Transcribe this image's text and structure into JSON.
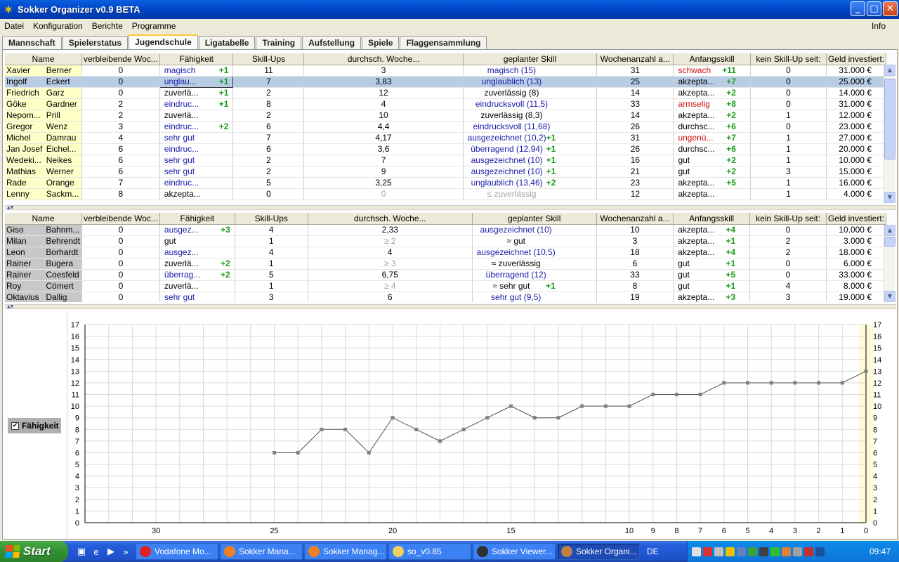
{
  "window": {
    "title": "Sokker Organizer v0.9 BETA"
  },
  "menu": {
    "items": [
      "Datei",
      "Konfiguration",
      "Berichte",
      "Programme"
    ],
    "info": "Info"
  },
  "tabs": [
    {
      "label": "Mannschaft"
    },
    {
      "label": "Spielerstatus"
    },
    {
      "label": "Jugendschule",
      "active": true
    },
    {
      "label": "Ligatabelle"
    },
    {
      "label": "Training"
    },
    {
      "label": "Aufstellung"
    },
    {
      "label": "Spiele"
    },
    {
      "label": "Flaggensammlung"
    }
  ],
  "columns": [
    "Name",
    "verbleibende Woc...",
    "Fähigkeit",
    "Skill-Ups",
    "durchsch. Woche...",
    "geplanter Skill",
    "Wochenanzahl a...",
    "Anfangsskill",
    "kein Skill-Up seit:",
    "Geld investiert:"
  ],
  "top_table": {
    "rows": [
      {
        "first": "Xavier",
        "last": "Berner",
        "weeks": "0",
        "skill": "magisch",
        "skill_up": "+1",
        "skill_color": "blue",
        "ups": "11",
        "avg": "3",
        "planned": "magisch (15)",
        "planned_up": "",
        "planned_color": "blue",
        "wcount": "31",
        "start": "schwach",
        "start_up": "+11",
        "start_color": "red",
        "since": "0",
        "money": "31.000 €"
      },
      {
        "first": "Ingolf",
        "last": "Eckert",
        "weeks": "0",
        "skill": "unglau...",
        "skill_up": "+1",
        "skill_color": "blue",
        "ups": "7",
        "avg": "3,83",
        "planned": "unglaublich (13)",
        "planned_up": "",
        "planned_color": "blue",
        "wcount": "25",
        "start": "akzepta...",
        "start_up": "+7",
        "start_color": "black",
        "since": "0",
        "money": "25.000 €",
        "selected": true
      },
      {
        "first": "Friedrich",
        "last": "Garz",
        "weeks": "0",
        "skill": "zuverlä...",
        "skill_up": "+1",
        "skill_color": "black",
        "ups": "2",
        "avg": "12",
        "planned": "zuverlässig (8)",
        "planned_up": "",
        "planned_color": "black",
        "wcount": "14",
        "start": "akzepta...",
        "start_up": "+2",
        "start_color": "black",
        "since": "0",
        "money": "14.000 €"
      },
      {
        "first": "Göke",
        "last": "Gardner",
        "weeks": "2",
        "skill": "eindruc...",
        "skill_up": "+1",
        "skill_color": "blue",
        "ups": "8",
        "avg": "4",
        "planned": "eindrucksvoll (11,5)",
        "planned_up": "",
        "planned_color": "blue",
        "wcount": "33",
        "start": "armselig",
        "start_up": "+8",
        "start_color": "red",
        "since": "0",
        "money": "31.000 €"
      },
      {
        "first": "Nepom...",
        "last": "Prill",
        "weeks": "2",
        "skill": "zuverlä...",
        "skill_up": "",
        "skill_color": "black",
        "ups": "2",
        "avg": "10",
        "planned": "zuverlässig (8,3)",
        "planned_up": "",
        "planned_color": "black",
        "wcount": "14",
        "start": "akzepta...",
        "start_up": "+2",
        "start_color": "black",
        "since": "1",
        "money": "12.000 €"
      },
      {
        "first": "Gregor",
        "last": "Wenz",
        "weeks": "3",
        "skill": "eindruc...",
        "skill_up": "+2",
        "skill_color": "blue",
        "ups": "6",
        "avg": "4,4",
        "planned": "eindrucksvoll (11,68)",
        "planned_up": "",
        "planned_color": "blue",
        "wcount": "26",
        "start": "durchsc...",
        "start_up": "+6",
        "start_color": "black",
        "since": "0",
        "money": "23.000 €"
      },
      {
        "first": "Michel",
        "last": "Damrau",
        "weeks": "4",
        "skill": "sehr gut",
        "skill_up": "",
        "skill_color": "blue",
        "ups": "7",
        "avg": "4,17",
        "planned": "ausgezeichnet (10,2)",
        "planned_up": "+1",
        "planned_color": "blue",
        "wcount": "31",
        "start": "ungenü...",
        "start_up": "+7",
        "start_color": "red",
        "since": "1",
        "money": "27.000 €"
      },
      {
        "first": "Jan Josef",
        "last": "Eichel...",
        "weeks": "6",
        "skill": "eindruc...",
        "skill_up": "",
        "skill_color": "blue",
        "ups": "6",
        "avg": "3,6",
        "planned": "überragend (12,94)",
        "planned_up": "+1",
        "planned_color": "blue",
        "wcount": "26",
        "start": "durchsc...",
        "start_up": "+6",
        "start_color": "black",
        "since": "1",
        "money": "20.000 €"
      },
      {
        "first": "Wedeki...",
        "last": "Neikes",
        "weeks": "6",
        "skill": "sehr gut",
        "skill_up": "",
        "skill_color": "blue",
        "ups": "2",
        "avg": "7",
        "planned": "ausgezeichnet (10)",
        "planned_up": "+1",
        "planned_color": "blue",
        "wcount": "16",
        "start": "gut",
        "start_up": "+2",
        "start_color": "black",
        "since": "1",
        "money": "10.000 €"
      },
      {
        "first": "Mathias",
        "last": "Werner",
        "weeks": "6",
        "skill": "sehr gut",
        "skill_up": "",
        "skill_color": "blue",
        "ups": "2",
        "avg": "9",
        "planned": "ausgezeichnet (10)",
        "planned_up": "+1",
        "planned_color": "blue",
        "wcount": "21",
        "start": "gut",
        "start_up": "+2",
        "start_color": "black",
        "since": "3",
        "money": "15.000 €"
      },
      {
        "first": "Rade",
        "last": "Orange",
        "weeks": "7",
        "skill": "eindruc...",
        "skill_up": "",
        "skill_color": "blue",
        "ups": "5",
        "avg": "3,25",
        "planned": "unglaublich (13,46)",
        "planned_up": "+2",
        "planned_color": "blue",
        "wcount": "23",
        "start": "akzepta...",
        "start_up": "+5",
        "start_color": "black",
        "since": "1",
        "money": "16.000 €"
      },
      {
        "first": "Lenny",
        "last": "Sackm...",
        "weeks": "8",
        "skill": "akzepta...",
        "skill_up": "",
        "skill_color": "black",
        "ups": "0",
        "avg": "0",
        "avg_color": "gray",
        "planned": "≤ zuverlässig",
        "planned_up": "",
        "planned_color": "gray",
        "wcount": "12",
        "start": "akzepta...",
        "start_up": "",
        "start_color": "black",
        "since": "1",
        "money": "4.000 €"
      }
    ]
  },
  "bottom_table": {
    "rows": [
      {
        "first": "Giso",
        "last": "Bahnm...",
        "weeks": "0",
        "skill": "ausgez...",
        "skill_up": "+3",
        "skill_color": "blue",
        "ups": "4",
        "avg": "2,33",
        "planned": "ausgezeichnet (10)",
        "planned_up": "",
        "planned_color": "blue",
        "wcount": "10",
        "start": "akzepta...",
        "start_up": "+4",
        "start_color": "black",
        "since": "0",
        "money": "10.000 €"
      },
      {
        "first": "Milan",
        "last": "Behrendt",
        "weeks": "0",
        "skill": "gut",
        "skill_up": "",
        "skill_color": "black",
        "ups": "1",
        "avg": "≥ 2",
        "avg_color": "gray",
        "planned": "≈ gut",
        "planned_up": "",
        "planned_color": "black",
        "wcount": "3",
        "start": "akzepta...",
        "start_up": "+1",
        "start_color": "black",
        "since": "2",
        "money": "3.000 €"
      },
      {
        "first": "Leon",
        "last": "Borhardt",
        "weeks": "0",
        "skill": "ausgez...",
        "skill_up": "",
        "skill_color": "blue",
        "ups": "4",
        "avg": "4",
        "planned": "ausgezeichnet (10,5)",
        "planned_up": "",
        "planned_color": "blue",
        "wcount": "18",
        "start": "akzepta...",
        "start_up": "+4",
        "start_color": "black",
        "since": "2",
        "money": "18.000 €"
      },
      {
        "first": "Rainer",
        "last": "Bugera",
        "weeks": "0",
        "skill": "zuverlä...",
        "skill_up": "+2",
        "skill_color": "black",
        "ups": "1",
        "avg": "≥ 3",
        "avg_color": "gray",
        "planned": "≈ zuverlässig",
        "planned_up": "",
        "planned_color": "black",
        "wcount": "6",
        "start": "gut",
        "start_up": "+1",
        "start_color": "black",
        "since": "0",
        "money": "6.000 €"
      },
      {
        "first": "Rainer",
        "last": "Coesfeld",
        "weeks": "0",
        "skill": "überrag...",
        "skill_up": "+2",
        "skill_color": "blue",
        "ups": "5",
        "avg": "6,75",
        "planned": "überragend (12)",
        "planned_up": "",
        "planned_color": "blue",
        "wcount": "33",
        "start": "gut",
        "start_up": "+5",
        "start_color": "black",
        "since": "0",
        "money": "33.000 €"
      },
      {
        "first": "Roy",
        "last": "Cömert",
        "weeks": "0",
        "skill": "zuverlä...",
        "skill_up": "",
        "skill_color": "black",
        "ups": "1",
        "avg": "≥ 4",
        "avg_color": "gray",
        "planned": "≈ sehr gut",
        "planned_up": "+1",
        "planned_color": "black",
        "wcount": "8",
        "start": "gut",
        "start_up": "+1",
        "start_color": "black",
        "since": "4",
        "money": "8.000 €"
      },
      {
        "first": "Oktavius",
        "last": "Dallig",
        "weeks": "0",
        "skill": "sehr gut",
        "skill_up": "",
        "skill_color": "blue",
        "ups": "3",
        "avg": "6",
        "planned": "sehr gut (9,5)",
        "planned_up": "",
        "planned_color": "blue",
        "wcount": "19",
        "start": "akzepta...",
        "start_up": "+3",
        "start_color": "black",
        "since": "3",
        "money": "19.000 €"
      }
    ]
  },
  "chart_data": {
    "type": "line",
    "series": [
      {
        "name": "Fähigkeit",
        "x": [
          25,
          24,
          23,
          22,
          21,
          20,
          19,
          18,
          17,
          16,
          15,
          14,
          13,
          12,
          11,
          10,
          9,
          8,
          7,
          6,
          5,
          4,
          3,
          2,
          1,
          0
        ],
        "values": [
          6,
          6,
          8,
          8,
          6,
          9,
          8,
          7,
          8,
          9,
          10,
          9,
          9,
          10,
          10,
          10,
          11,
          11,
          11,
          12,
          12,
          12,
          12,
          12,
          12,
          13
        ]
      }
    ],
    "xlim": [
      0,
      33
    ],
    "x_ticks": [
      30,
      25,
      20,
      15,
      10,
      9,
      8,
      7,
      6,
      5,
      4,
      3,
      2,
      1,
      0
    ],
    "ylim": [
      0,
      17
    ],
    "y_ticks": [
      0,
      1,
      2,
      3,
      4,
      5,
      6,
      7,
      8,
      9,
      10,
      11,
      12,
      13,
      14,
      15,
      16,
      17
    ],
    "grid": true,
    "legend": "left",
    "colors": {
      "line": "#505050",
      "marker": "#808080",
      "grid": "#d8d8d8",
      "highlight": "#fffbd8"
    }
  },
  "legend": {
    "label": "Fähigkeit",
    "checked": "✔"
  },
  "taskbar": {
    "start": "Start",
    "buttons": [
      {
        "label": "Vodafone Mo...",
        "color": "#e02020"
      },
      {
        "label": "Sokker Mana...",
        "color": "#f08020"
      },
      {
        "label": "Sokker Manag...",
        "color": "#f08020"
      },
      {
        "label": "so_v0.85",
        "color": "#f0d060"
      },
      {
        "label": "Sokker Viewer...",
        "color": "#303030"
      },
      {
        "label": "Sokker Organi...",
        "color": "#c08040",
        "active": true
      }
    ],
    "lang": "DE",
    "clock": "09:47"
  }
}
